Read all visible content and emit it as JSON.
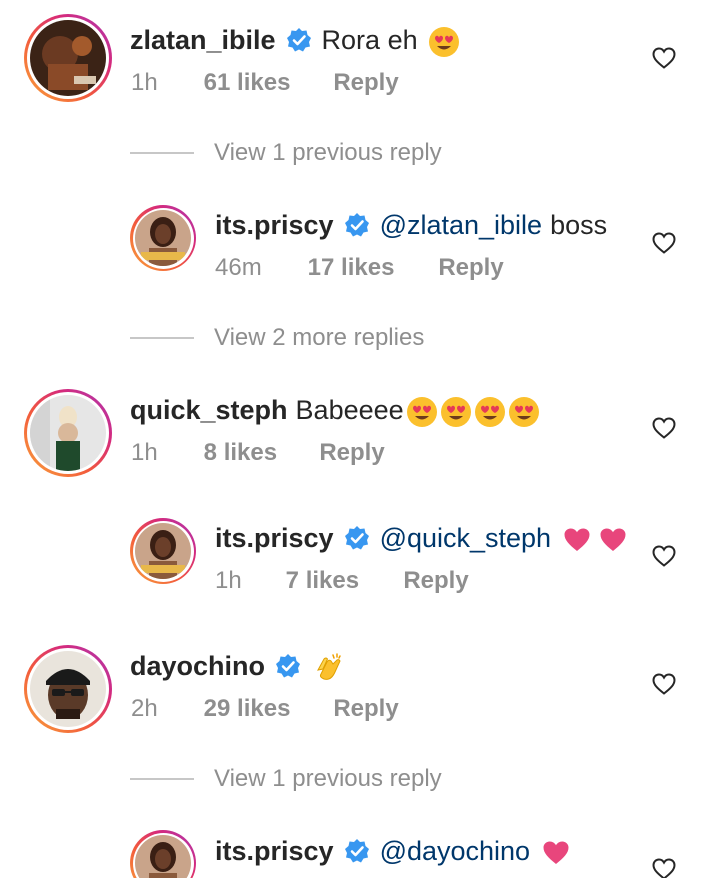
{
  "comments": [
    {
      "username": "zlatan_ibile",
      "text": "Rora eh",
      "time": "1h",
      "likes": "61 likes",
      "reply": "Reply",
      "verified": true
    },
    {
      "username": "its.priscy",
      "mention": "@zlatan_ibile",
      "text": "boss",
      "time": "46m",
      "likes": "17 likes",
      "reply": "Reply",
      "verified": true
    },
    {
      "username": "quick_steph",
      "text": "Babeeee",
      "time": "1h",
      "likes": "8 likes",
      "reply": "Reply",
      "verified": false
    },
    {
      "username": "its.priscy",
      "mention": "@quick_steph",
      "time": "1h",
      "likes": "7 likes",
      "reply": "Reply",
      "verified": true
    },
    {
      "username": "dayochino",
      "time": "2h",
      "likes": "29 likes",
      "reply": "Reply",
      "verified": true
    },
    {
      "username": "its.priscy",
      "mention": "@dayochino",
      "verified": true
    }
  ],
  "view_replies": [
    "View 1 previous reply",
    "View 2 more replies",
    "View 1 previous reply"
  ],
  "colors": {
    "mention": "#00376b",
    "verified": "#3897f0",
    "heart_emoji": "#e8467c",
    "meta": "#8e8e8e"
  },
  "icons": {
    "like": "heart-outline-icon",
    "verified": "verified-badge-icon",
    "heart_eyes": "heart-eyes-emoji",
    "clap": "clapping-hands-emoji",
    "pink_heart": "pink-heart-emoji"
  }
}
